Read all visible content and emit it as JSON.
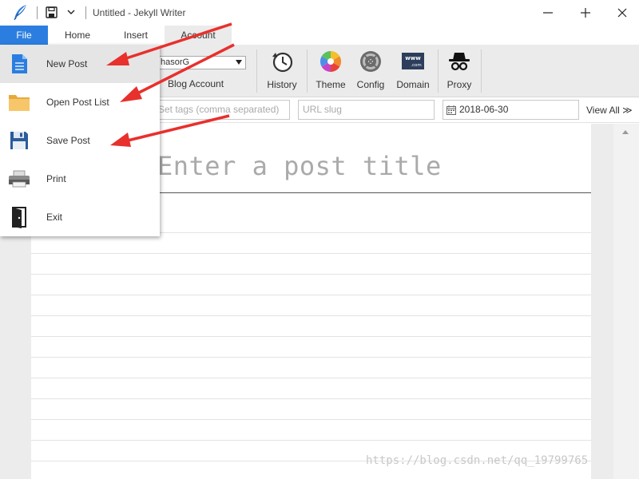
{
  "window": {
    "title": "Untitled - Jekyll Writer",
    "logo_icon": "feather-icon",
    "minimize_icon": "minimize-icon",
    "maximize_icon": "maximize-icon",
    "close_icon": "close-icon"
  },
  "tabs": [
    {
      "label": "File",
      "active": true
    },
    {
      "label": "Home"
    },
    {
      "label": "Insert"
    },
    {
      "label": "Account"
    }
  ],
  "ribbon": {
    "account_value": "hasorG",
    "blog_account_label": "Blog Account",
    "buttons": [
      {
        "label": "History",
        "icon": "history-icon"
      },
      {
        "label": "Theme",
        "icon": "color-wheel-icon"
      },
      {
        "label": "Config",
        "icon": "gear-icon"
      },
      {
        "label": "Domain",
        "icon": "www-icon"
      },
      {
        "label": "Proxy",
        "icon": "spy-icon"
      }
    ]
  },
  "metabar": {
    "tags_placeholder": "Set tags (comma separated)",
    "slug_placeholder": "URL slug",
    "date_value": "2018-06-30",
    "view_all_label": "View All ≫"
  },
  "editor": {
    "title_placeholder": "Enter a post title"
  },
  "file_menu": {
    "items": [
      {
        "label": "New Post",
        "icon": "document-icon",
        "active": true
      },
      {
        "label": "Open Post List",
        "icon": "folder-icon"
      },
      {
        "label": "Save Post",
        "icon": "floppy-disk-icon"
      },
      {
        "label": "Print",
        "icon": "printer-icon"
      },
      {
        "label": "Exit",
        "icon": "exit-door-icon"
      }
    ]
  },
  "annotation": {
    "arrow_color": "#e8302c"
  },
  "colors": {
    "accent": "#2b7ee0",
    "ribbon_bg": "#ebebeb",
    "menu_active": "#e5e5e5"
  },
  "watermark": "https://blog.csdn.net/qq_19799765"
}
